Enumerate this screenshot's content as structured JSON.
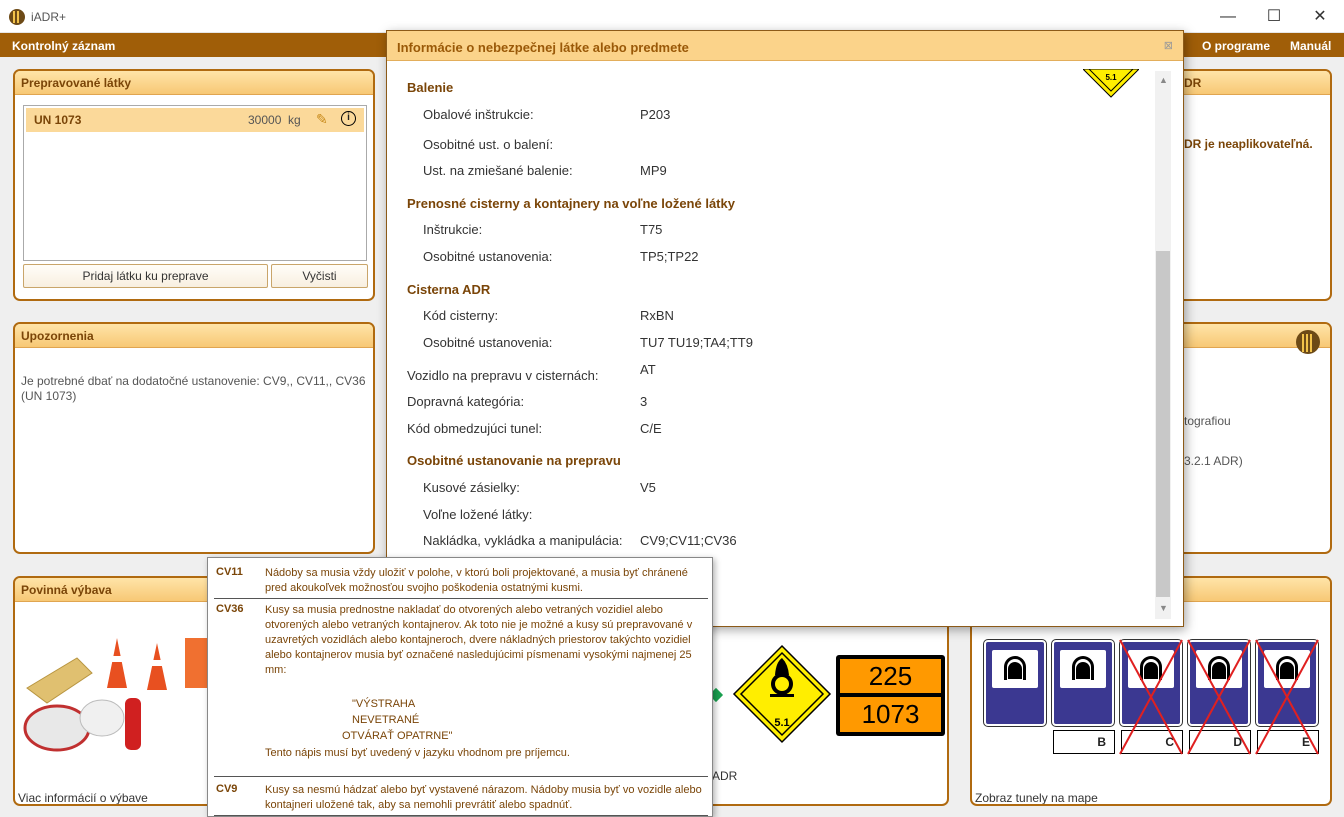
{
  "window": {
    "title": "iADR+",
    "minimize": "—",
    "maximize": "☐",
    "close": "✕"
  },
  "menu": {
    "left": "Kontrolný záznam",
    "about": "O programe",
    "manual": "Manuál"
  },
  "substances": {
    "title": "Prepravované látky",
    "rows": [
      {
        "un": "UN 1073",
        "qty": "30000",
        "unit": "kg"
      }
    ],
    "add_button": "Pridaj látku ku preprave",
    "clear_button": "Vyčisti"
  },
  "warnings": {
    "title": "Upozornenia",
    "text": "Je potrebné dbať na dodatočné ustanovenie:  CV9,, CV11,, CV36 (UN 1073)"
  },
  "equipment": {
    "title": "Povinná výbava",
    "link": "Viac informácií o výbave"
  },
  "right_top": {
    "title_fragment": "DR",
    "text_fragment": "DR je neaplikovateľná."
  },
  "right_mid": {
    "text1": "tografiou",
    "text2": "3.2.1 ADR)"
  },
  "labels_panel": {
    "link_fragment": "ADR",
    "class_label": "5.1"
  },
  "orange_plate": {
    "hazard": "225",
    "un": "1073"
  },
  "tunnels": {
    "link": "Zobraz tunely na mape",
    "labels": [
      "B",
      "C",
      "D",
      "E"
    ]
  },
  "dialog": {
    "title": "Informácie o nebezpečnej látke alebo predmete",
    "close": "⊠",
    "diamond_label": "5.1",
    "sections": {
      "packaging": "Balenie",
      "portable_tanks": "Prenosné cisterny a kontajnery na voľne ložené látky",
      "adr_tank": "Cisterna ADR",
      "special_transport": "Osobitné ustanovanie na prepravu"
    },
    "rows": [
      {
        "label": "Obalové inštrukcie:",
        "value": "P203"
      },
      {
        "label": "Osobitné ust. o balení:",
        "value": ""
      },
      {
        "label": "Ust. na zmiešané balenie:",
        "value": "MP9"
      },
      {
        "label": "Inštrukcie:",
        "value": "T75"
      },
      {
        "label": "Osobitné ustanovenia:",
        "value": "TP5;TP22"
      },
      {
        "label": "Kód cisterny:",
        "value": "RxBN"
      },
      {
        "label": "Osobitné ustanovenia:",
        "value": "TU7 TU19;TA4;TT9"
      },
      {
        "label": "Vozidlo na prepravu v cisternách:",
        "value": "AT"
      },
      {
        "label": "Dopravná kategória:",
        "value": "3"
      },
      {
        "label": "Kód obmedzujúci tunel:",
        "value": "C/E"
      },
      {
        "label": "Kusové zásielky:",
        "value": "V5"
      },
      {
        "label": "Voľne ložené látky:",
        "value": ""
      },
      {
        "label": "Nakládka, vykládka a manipulácia:",
        "value": "CV9;CV11;CV36"
      }
    ]
  },
  "tooltip": {
    "items": [
      {
        "code": "CV11",
        "text": "Nádoby sa musia vždy uložiť v polohe, v ktorú boli projektované, a musia byť chránené pred akoukoľvek možnosťou svojho poškodenia ostatnými kusmi."
      },
      {
        "code": "CV36",
        "text": "Kusy sa musia prednostne nakladať do otvorených alebo vetraných vozidiel alebo otvorených alebo vetraných kontajnerov. Ak toto nie je možné a kusy sú prepravované v uzavretých vozidlách alebo kontajneroch, dvere nákladných priestorov takýchto vozidiel alebo kontajnerov musia byť označené nasledujúcimi písmenami vysokými najmenej 25 mm:",
        "sign1": "\"VÝSTRAHA",
        "sign2": "NEVETRANÉ",
        "sign3": "OTVÁRAŤ OPATRNE\"",
        "tail": "Tento nápis musí byť uvedený v jazyku vhodnom pre príjemcu."
      },
      {
        "code": "CV9",
        "text": "Kusy sa nesmú hádzať alebo byť vystavené nárazom. Nádoby musia  byť vo vozidle alebo kontajneri uložené tak, aby sa nemohli prevrátiť alebo spadnúť."
      }
    ]
  },
  "colors": {
    "accent": "#a05e08",
    "header_fill": "#f7c875",
    "orange_plate": "#ff9900",
    "tunnel_blue": "#3b3891",
    "label_yellow": "#ffee00"
  }
}
